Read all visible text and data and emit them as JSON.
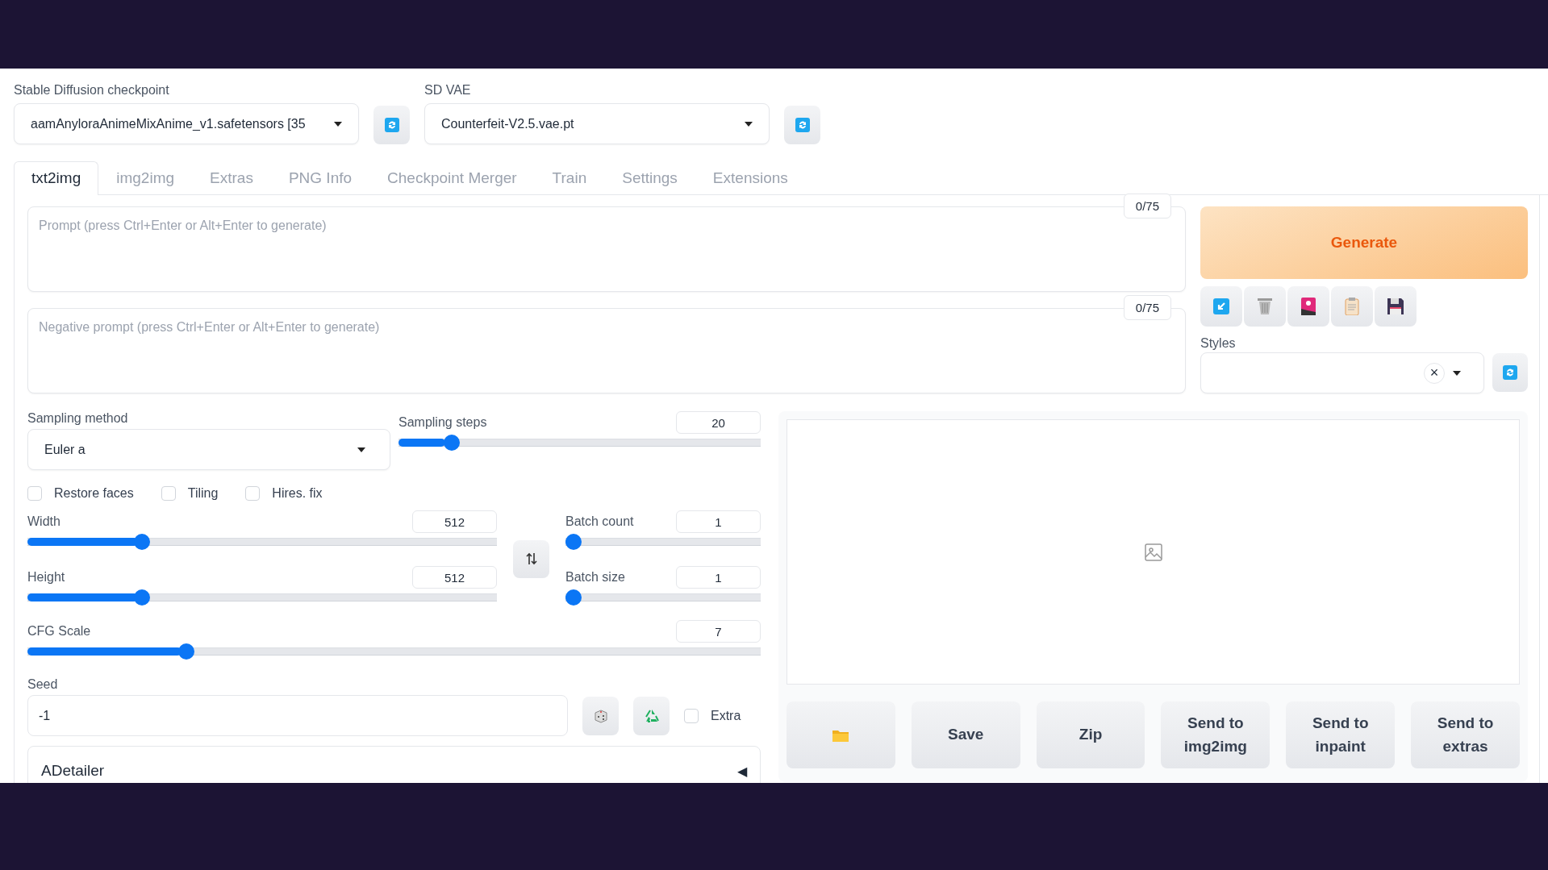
{
  "checkpoint": {
    "label": "Stable Diffusion checkpoint",
    "value": "aamAnyloraAnimeMixAnime_v1.safetensors [35"
  },
  "vae": {
    "label": "SD VAE",
    "value": "Counterfeit-V2.5.vae.pt"
  },
  "tabs": [
    {
      "label": "txt2img",
      "selected": true
    },
    {
      "label": "img2img",
      "selected": false
    },
    {
      "label": "Extras",
      "selected": false
    },
    {
      "label": "PNG Info",
      "selected": false
    },
    {
      "label": "Checkpoint Merger",
      "selected": false
    },
    {
      "label": "Train",
      "selected": false
    },
    {
      "label": "Settings",
      "selected": false
    },
    {
      "label": "Extensions",
      "selected": false
    }
  ],
  "prompt": {
    "placeholder": "Prompt (press Ctrl+Enter or Alt+Enter to generate)",
    "counter": "0/75"
  },
  "negative_prompt": {
    "placeholder": "Negative prompt (press Ctrl+Enter or Alt+Enter to generate)",
    "counter": "0/75"
  },
  "generate_button": "Generate",
  "tool_buttons": [
    {
      "kind": "arrow"
    },
    {
      "kind": "trash"
    },
    {
      "kind": "picture"
    },
    {
      "kind": "clipboard"
    },
    {
      "kind": "save"
    }
  ],
  "styles": {
    "label": "Styles",
    "clear": "×"
  },
  "sampling_method": {
    "label": "Sampling method",
    "value": "Euler a"
  },
  "sampling_steps": {
    "label": "Sampling steps",
    "value": "20",
    "level": 0.13
  },
  "checkboxes": [
    {
      "label": "Restore faces",
      "checked": false
    },
    {
      "label": "Tiling",
      "checked": false
    },
    {
      "label": "Hires. fix",
      "checked": false
    }
  ],
  "width": {
    "label": "Width",
    "value": "512",
    "level": 0.235
  },
  "height": {
    "label": "Height",
    "value": "512",
    "level": 0.235
  },
  "batch_count": {
    "label": "Batch count",
    "value": "1",
    "level": 0
  },
  "batch_size": {
    "label": "Batch size",
    "value": "1",
    "level": 0
  },
  "cfg_scale": {
    "label": "CFG Scale",
    "value": "7",
    "level": 0.21
  },
  "seed": {
    "label": "Seed",
    "value": "-1",
    "extra": {
      "label": "Extra",
      "checked": false
    }
  },
  "adetailer": {
    "label": "ADetailer",
    "arrow": "◀"
  },
  "output_buttons": [
    {
      "kind": "folder"
    },
    {
      "kind": "text",
      "label": "Save"
    },
    {
      "kind": "text",
      "label": "Zip"
    },
    {
      "kind": "text",
      "label": "Send to img2img"
    },
    {
      "kind": "text",
      "label": "Send to inpaint"
    },
    {
      "kind": "text",
      "label": "Send to extras"
    }
  ]
}
